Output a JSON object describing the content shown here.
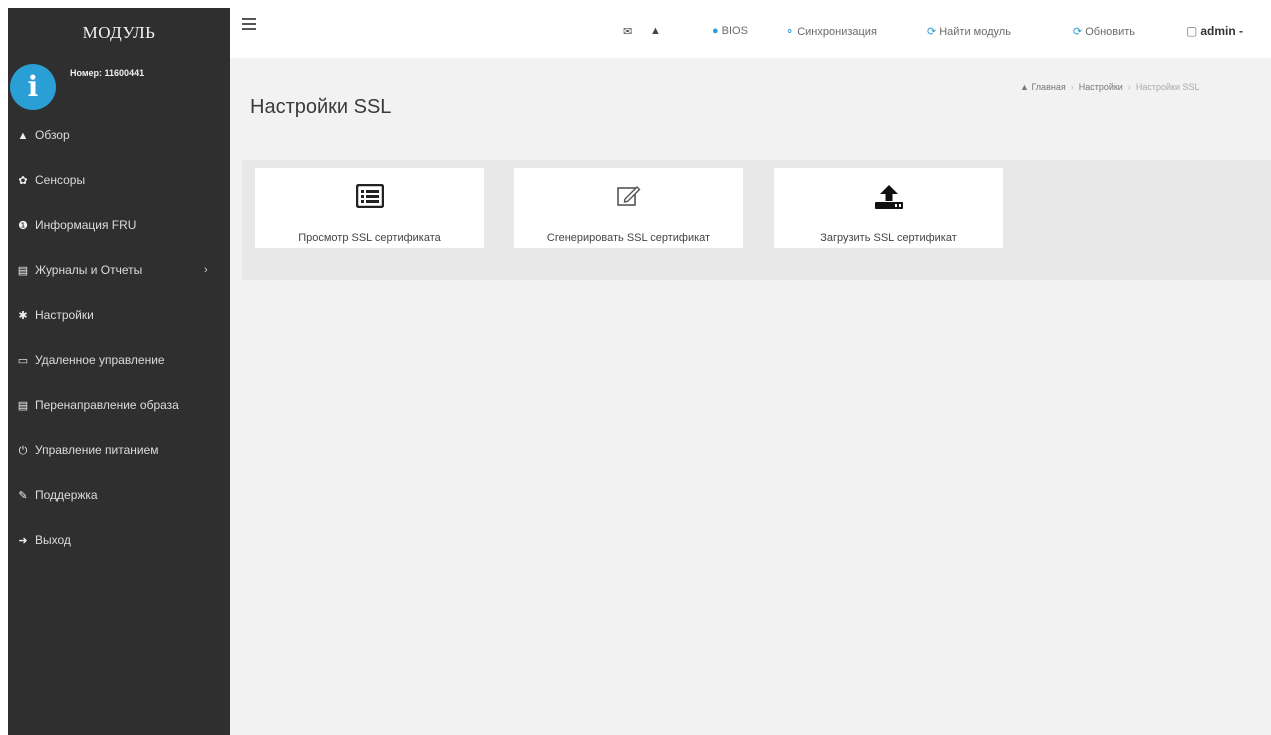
{
  "sidebar": {
    "brand": "МОДУЛЬ",
    "user_label": "Номер: 11600441",
    "items": [
      {
        "icon": "home-icon",
        "label": "Обзор"
      },
      {
        "icon": "dashboard-icon",
        "label": "Сенсоры"
      },
      {
        "icon": "info-circle-icon",
        "label": "Информация FRU"
      },
      {
        "icon": "bar-chart-icon",
        "label": "Журналы и Отчеты",
        "chevron": "›"
      },
      {
        "icon": "gear-icon",
        "label": "Настройки"
      },
      {
        "icon": "monitor-icon",
        "label": "Удаленное управление"
      },
      {
        "icon": "hdd-icon",
        "label": "Перенаправление образа"
      },
      {
        "icon": "power-icon",
        "label": "Управление питанием"
      },
      {
        "icon": "wrench-icon",
        "label": "Поддержка"
      },
      {
        "icon": "sign-out-icon",
        "label": "Выход"
      }
    ]
  },
  "topbar": {
    "bios_label": "BIOS",
    "sync_label": "Синхронизация",
    "find_label": "Найти модуль",
    "refresh_label": "Обновить",
    "user_label": "admin -"
  },
  "page": {
    "title": "Настройки SSL",
    "breadcrumb": [
      "Главная",
      "Настройки",
      "Настройки SSL"
    ]
  },
  "cards": [
    {
      "icon": "list-icon",
      "label": "Просмотр SSL сертификата"
    },
    {
      "icon": "edit-icon",
      "label": "Сгенерировать SSL сертификат"
    },
    {
      "icon": "upload-icon",
      "label": "Загрузить SSL сертификат"
    }
  ],
  "colors": {
    "sidebar_bg": "#2f2f2f",
    "info_blue": "#2a9fd6",
    "content_bg": "#f2f2f2"
  }
}
